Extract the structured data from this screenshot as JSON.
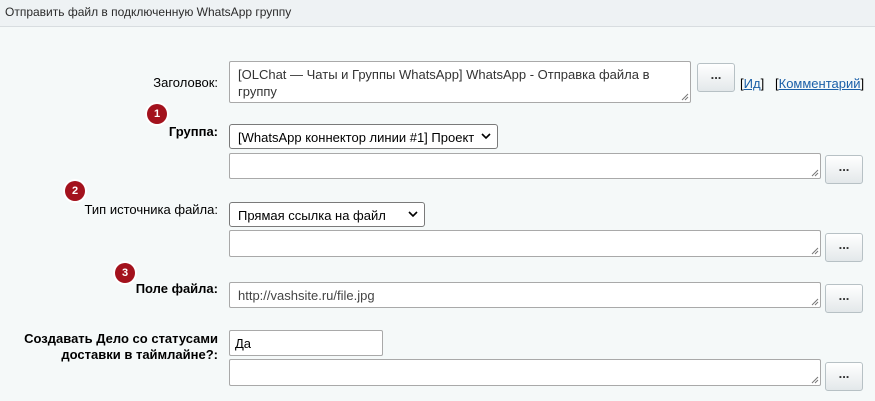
{
  "header": {
    "title": "Отправить файл в подключенную WhatsApp группу"
  },
  "fields": {
    "title": {
      "label": "Заголовок:",
      "value": "[OLChat — Чаты и Группы WhatsApp] WhatsApp - Отправка файла в группу",
      "button": "...",
      "link_id": "Ид",
      "link_comment": "Комментарий"
    },
    "group": {
      "badge": "1",
      "label": "Группа:",
      "selected": "[WhatsApp коннектор линии #1] Проект",
      "button": "..."
    },
    "source_type": {
      "badge": "2",
      "label": "Тип источника файла:",
      "selected": "Прямая ссылка на файл",
      "button": "..."
    },
    "file_field": {
      "badge": "3",
      "label": "Поле файла:",
      "value": "http://vashsite.ru/file.jpg",
      "button": "..."
    },
    "create_task": {
      "label": "Создавать Дело со статусами доставки в таймлайне?:",
      "value": "Да",
      "button": "..."
    }
  },
  "colors": {
    "badge": "#a3121d",
    "link": "#1a5fa8",
    "background": "#f5f9f9"
  }
}
